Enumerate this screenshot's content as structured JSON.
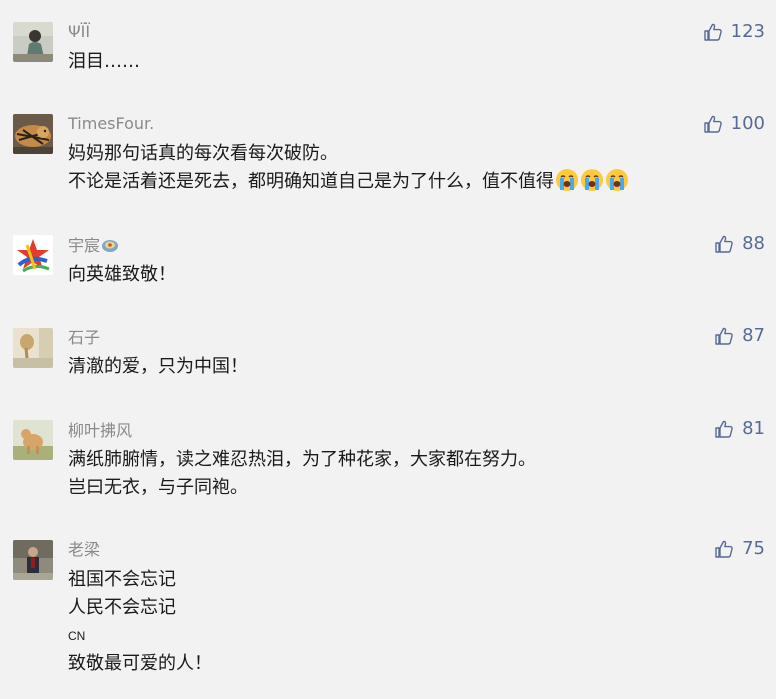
{
  "comments": [
    {
      "username": "ΨÏÏ",
      "likes": "123",
      "lines": [
        "泪目……"
      ]
    },
    {
      "username": "TimesFour.",
      "likes": "100",
      "lines": [
        "妈妈那句话真的每次看每次破防。",
        "不论是活着还是死去，都明确知道自己是为了什么，值不值得"
      ],
      "emoji": "crying-face-icon"
    },
    {
      "username": "宇宸",
      "likes": "88",
      "lines": [
        "向英雄致敬！"
      ],
      "badge": "medal-badge-icon"
    },
    {
      "username": "石子",
      "likes": "87",
      "lines": [
        "清澈的爱，只为中国！"
      ]
    },
    {
      "username": "柳叶拂风",
      "likes": "81",
      "lines": [
        "满纸肺腑情，读之难忍热泪，为了种花家，大家都在努力。",
        "岂曰无衣，与子同袍。"
      ]
    },
    {
      "username": "老梁",
      "likes": "75",
      "lines": [
        "祖国不会忘记",
        "人民不会忘记",
        "CN",
        "致敬最可爱的人！"
      ]
    }
  ],
  "colors": {
    "background": "#f2f2f2",
    "username": "#8a8a8a",
    "likes": "#576b95",
    "text": "#1a1a1a"
  }
}
